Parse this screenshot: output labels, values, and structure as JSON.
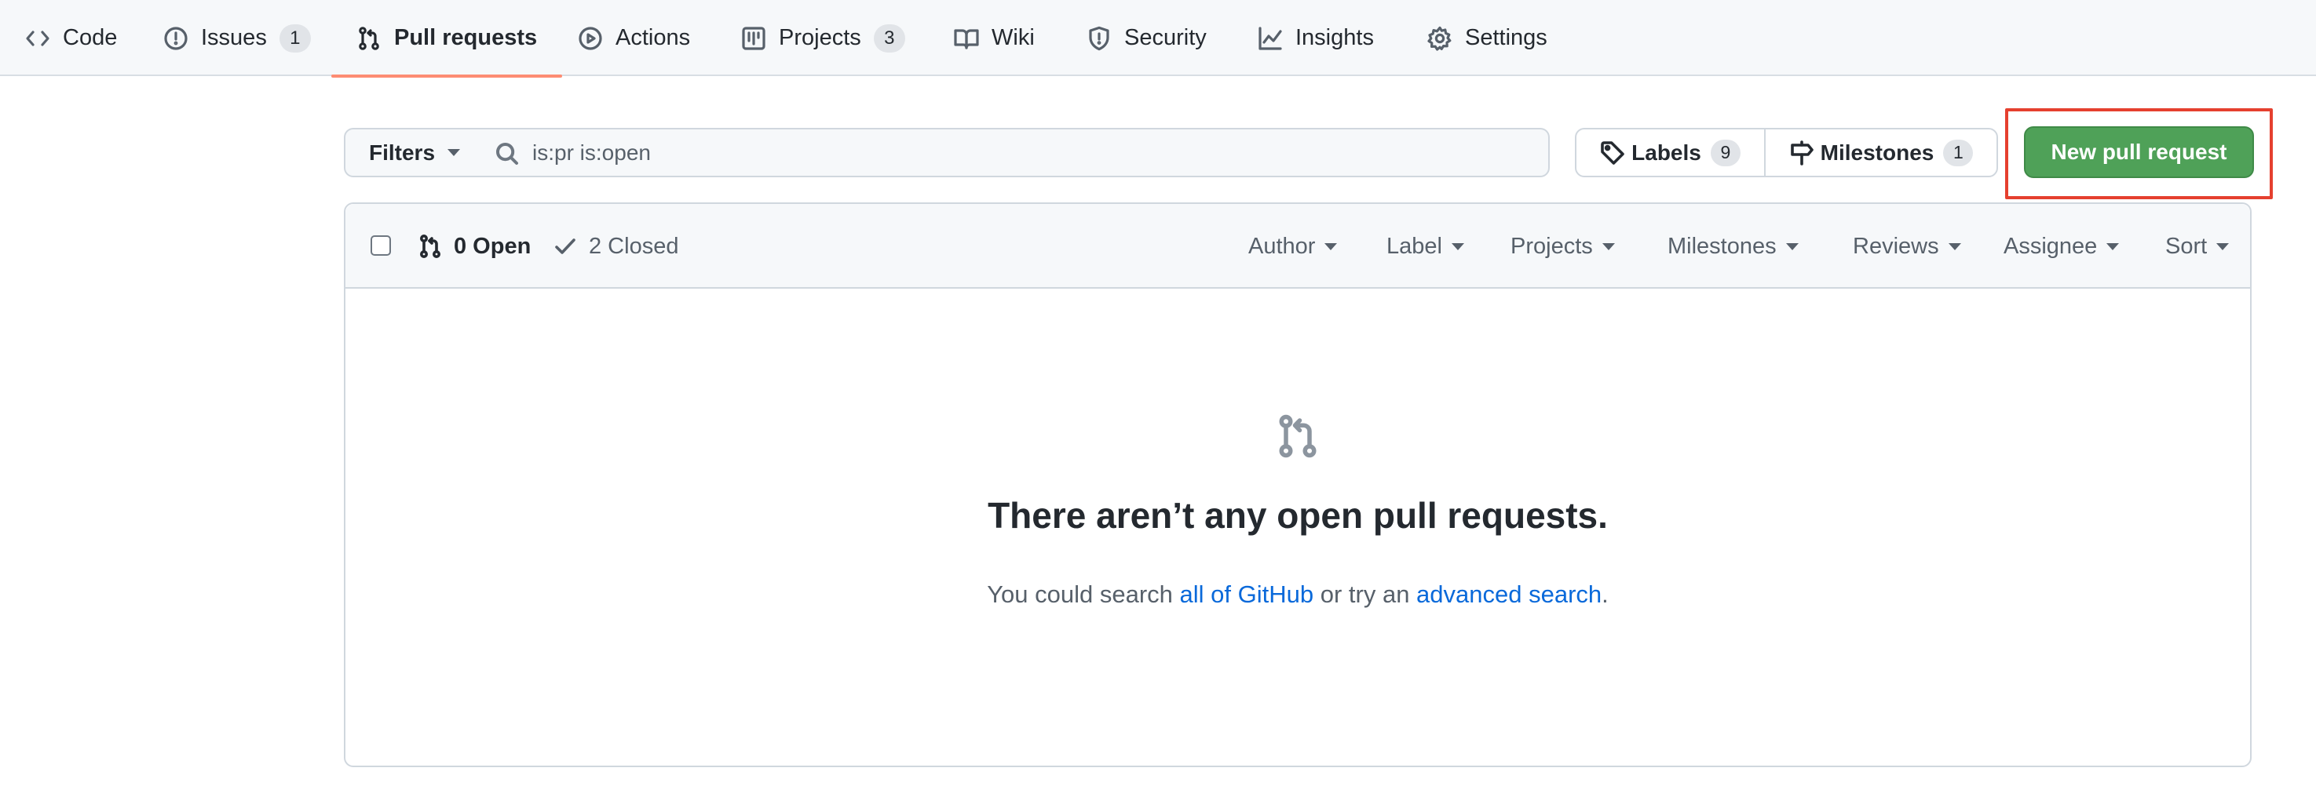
{
  "repo_nav": {
    "tabs": [
      {
        "label": "Code",
        "icon": "code-icon"
      },
      {
        "label": "Issues",
        "icon": "issue-opened-icon",
        "count": "1"
      },
      {
        "label": "Pull requests",
        "icon": "git-pull-request-icon",
        "selected": true
      },
      {
        "label": "Actions",
        "icon": "play-icon"
      },
      {
        "label": "Projects",
        "icon": "project-icon",
        "count": "3"
      },
      {
        "label": "Wiki",
        "icon": "book-icon"
      },
      {
        "label": "Security",
        "icon": "shield-icon"
      },
      {
        "label": "Insights",
        "icon": "graph-icon"
      },
      {
        "label": "Settings",
        "icon": "gear-icon"
      }
    ],
    "selected_underline_color": "#fd8c73"
  },
  "subnav": {
    "filters_label": "Filters",
    "search_value": "is:pr is:open",
    "labels_label": "Labels",
    "labels_count": "9",
    "milestones_label": "Milestones",
    "milestones_count": "1",
    "new_pr_label": "New pull request",
    "new_pr_color": "#4fa158",
    "highlight_color": "#e5402f"
  },
  "list_header": {
    "open_label": "0 Open",
    "closed_label": "2 Closed",
    "filters": [
      "Author",
      "Label",
      "Projects",
      "Milestones",
      "Reviews",
      "Assignee",
      "Sort"
    ]
  },
  "blankslate": {
    "title": "There aren’t any open pull requests.",
    "desc_prefix": "You could search ",
    "link1": "all of GitHub",
    "desc_middle": " or try an ",
    "link2": "advanced search",
    "desc_suffix": ".",
    "link_color": "#0969da"
  }
}
